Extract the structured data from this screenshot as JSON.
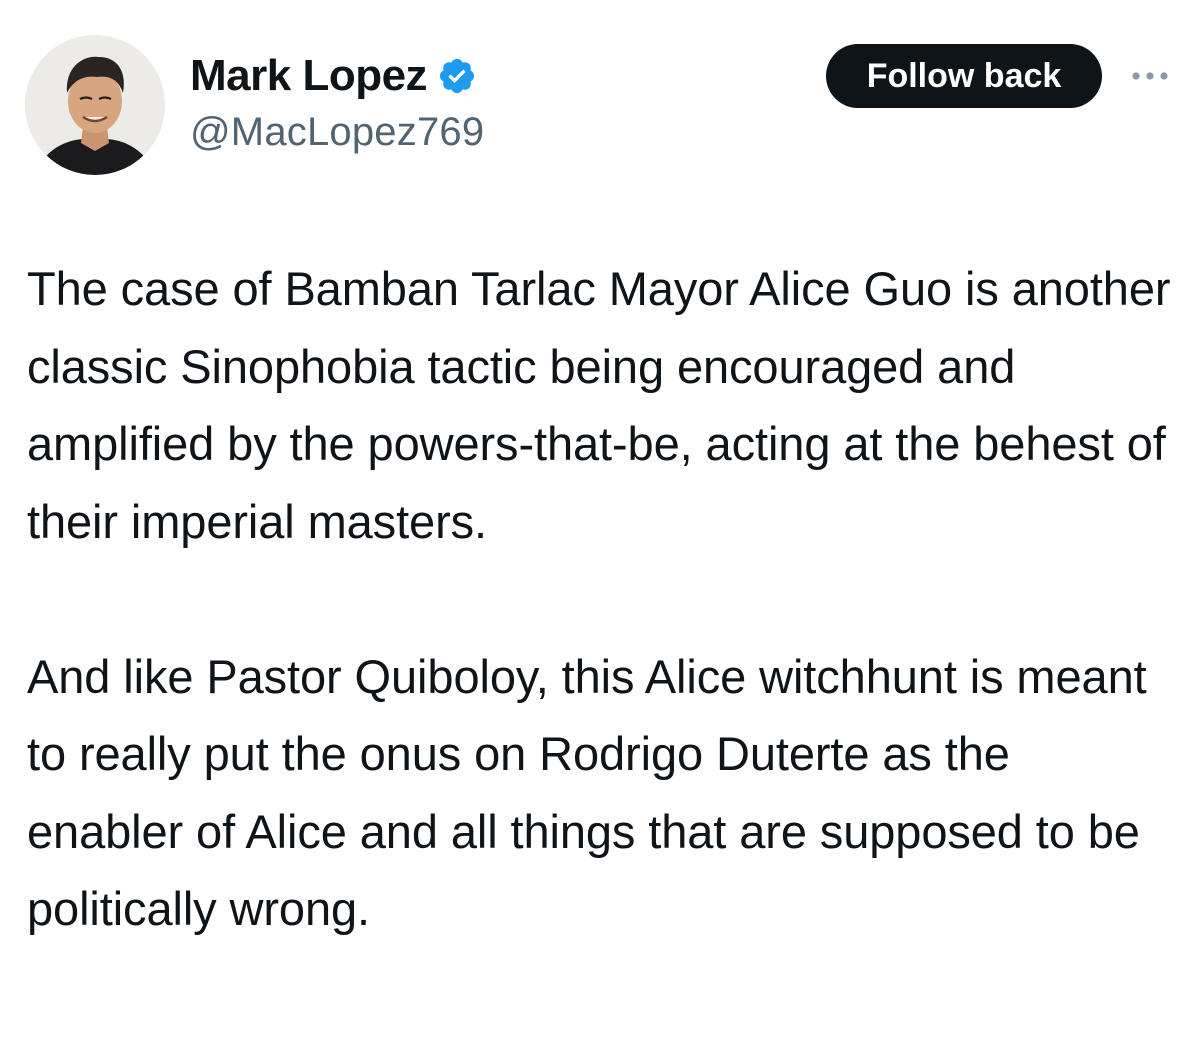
{
  "user": {
    "display_name": "Mark Lopez",
    "handle": "@MacLopez769",
    "verified": true,
    "avatar_icon": "profile-photo"
  },
  "actions": {
    "follow_label": "Follow back",
    "more_icon": "more-horizontal-icon"
  },
  "tweet": {
    "paragraphs": [
      "The case of Bamban Tarlac Mayor Alice Guo is another classic Sinophobia tactic being encouraged and amplified by the powers-that-be, acting at the behest of their imperial masters.",
      "And like Pastor Quiboloy, this Alice witchhunt is meant to really put the onus on Rodrigo Duterte as the enabler of Alice and all things that are supposed to be politically wrong."
    ]
  },
  "colors": {
    "text_primary": "#0f1419",
    "text_secondary": "#536471",
    "verified_blue": "#1d9bf0",
    "button_bg": "#0f1419",
    "button_text": "#ffffff"
  }
}
